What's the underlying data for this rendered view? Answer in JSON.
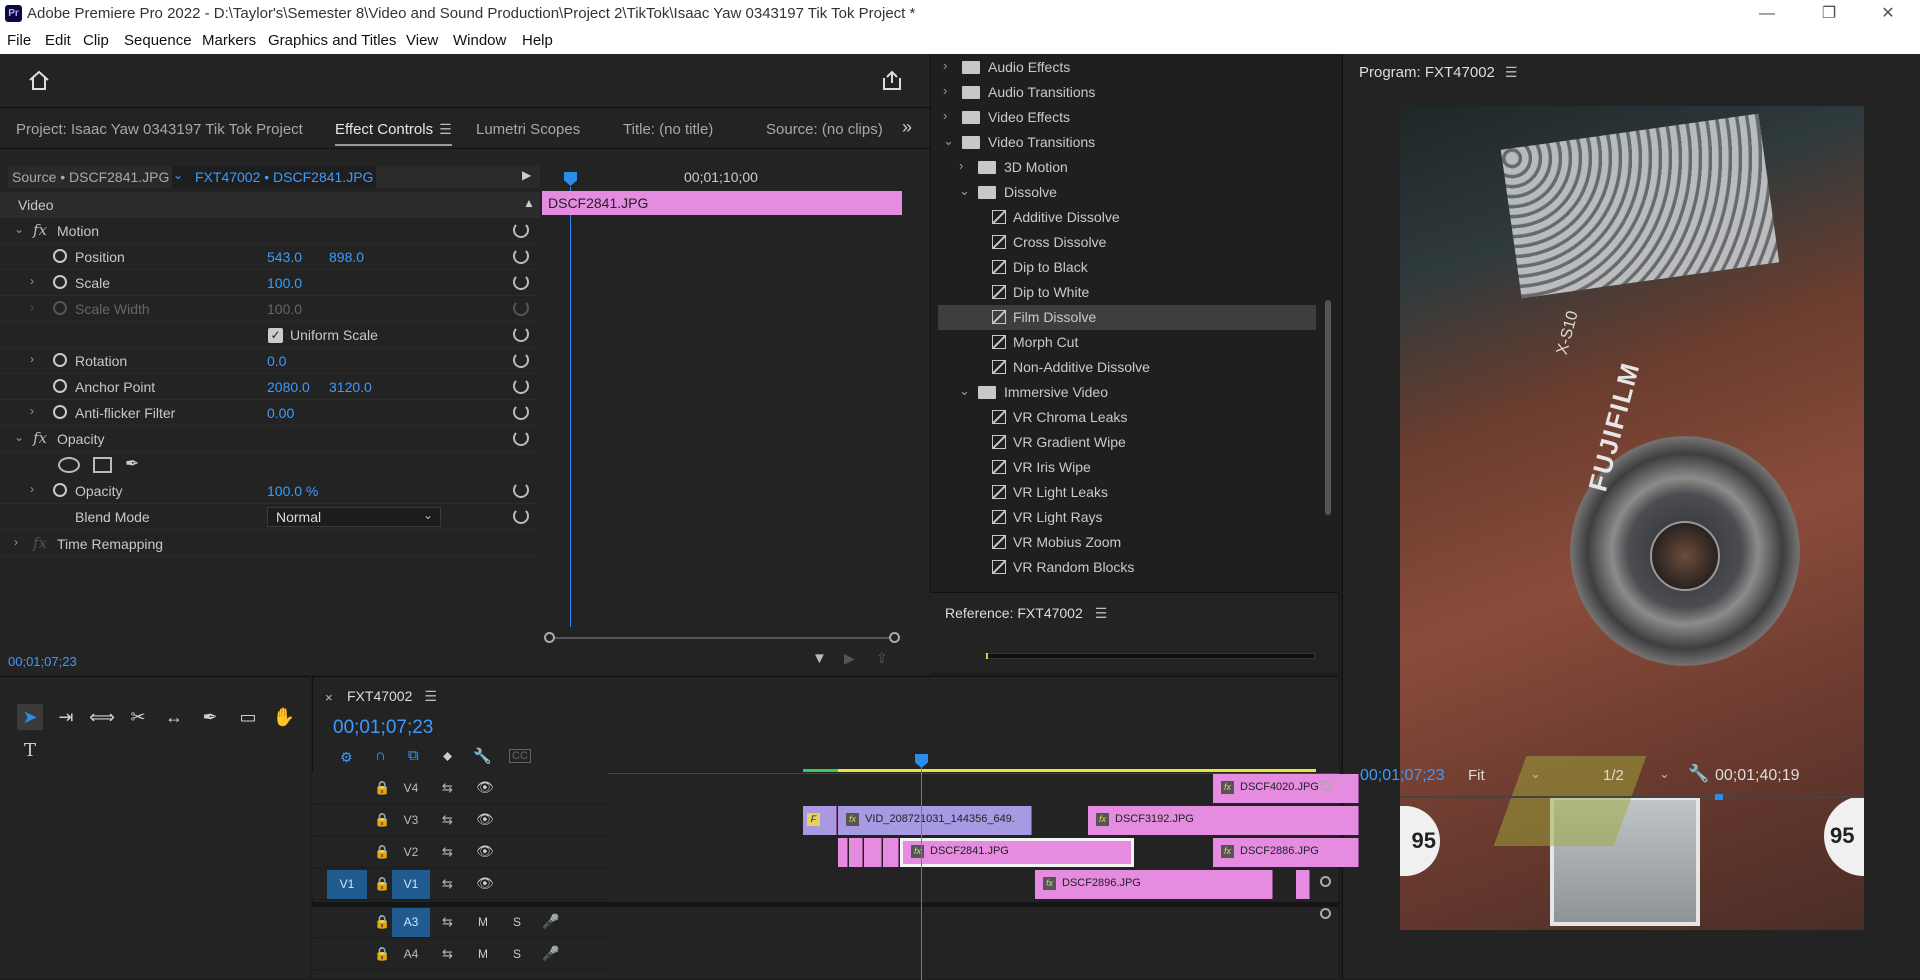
{
  "window": {
    "app_icon": "Pr",
    "title": "Adobe Premiere Pro 2022 - D:\\Taylor's\\Semester 8\\Video and Sound Production\\Project 2\\TikTok\\Isaac Yaw 0343197 Tik Tok Project *",
    "controls": [
      "—",
      "❐",
      "✕"
    ]
  },
  "menu": [
    "File",
    "Edit",
    "Clip",
    "Sequence",
    "Markers",
    "Graphics and Titles",
    "View",
    "Window",
    "Help"
  ],
  "panel_tabs": {
    "project": "Project: Isaac Yaw 0343197 Tik Tok Project",
    "effect_controls": "Effect Controls",
    "lumetri": "Lumetri Scopes",
    "title": "Title: (no title)",
    "source": "Source: (no clips)",
    "more": "»"
  },
  "effect_controls": {
    "source_label": "Source • DSCF2841.JPG",
    "sequence_label": "FXT47002 • DSCF2841.JPG",
    "timecode_ruler": "00;01;10;00",
    "clip_name": "DSCF2841.JPG",
    "section_video": "Video",
    "motion": "Motion",
    "position": {
      "label": "Position",
      "x": "543.0",
      "y": "898.0"
    },
    "scale": {
      "label": "Scale",
      "value": "100.0"
    },
    "scale_width": {
      "label": "Scale Width",
      "value": "100.0"
    },
    "uniform_scale": "Uniform Scale",
    "rotation": {
      "label": "Rotation",
      "value": "0.0"
    },
    "anchor_point": {
      "label": "Anchor Point",
      "x": "2080.0",
      "y": "3120.0"
    },
    "anti_flicker": {
      "label": "Anti-flicker Filter",
      "value": "0.00"
    },
    "opacity_section": "Opacity",
    "opacity": {
      "label": "Opacity",
      "value": "100.0 %"
    },
    "blend_mode": {
      "label": "Blend Mode",
      "value": "Normal"
    },
    "time_remapping": "Time Remapping",
    "current_time": "00;01;07;23"
  },
  "effects_tree": [
    {
      "label": "Audio Effects",
      "level": 0,
      "type": "folder",
      "open": false
    },
    {
      "label": "Audio Transitions",
      "level": 0,
      "type": "folder",
      "open": false
    },
    {
      "label": "Video Effects",
      "level": 0,
      "type": "folder",
      "open": false
    },
    {
      "label": "Video Transitions",
      "level": 0,
      "type": "folder",
      "open": true
    },
    {
      "label": "3D Motion",
      "level": 1,
      "type": "folder",
      "open": false
    },
    {
      "label": "Dissolve",
      "level": 1,
      "type": "folder",
      "open": true
    },
    {
      "label": "Additive Dissolve",
      "level": 2,
      "type": "effect"
    },
    {
      "label": "Cross Dissolve",
      "level": 2,
      "type": "effect"
    },
    {
      "label": "Dip to Black",
      "level": 2,
      "type": "effect"
    },
    {
      "label": "Dip to White",
      "level": 2,
      "type": "effect"
    },
    {
      "label": "Film Dissolve",
      "level": 2,
      "type": "effect",
      "selected": true
    },
    {
      "label": "Morph Cut",
      "level": 2,
      "type": "effect"
    },
    {
      "label": "Non-Additive Dissolve",
      "level": 2,
      "type": "effect"
    },
    {
      "label": "Immersive Video",
      "level": 1,
      "type": "folder",
      "open": true
    },
    {
      "label": "VR Chroma Leaks",
      "level": 2,
      "type": "effect"
    },
    {
      "label": "VR Gradient Wipe",
      "level": 2,
      "type": "effect"
    },
    {
      "label": "VR Iris Wipe",
      "level": 2,
      "type": "effect"
    },
    {
      "label": "VR Light Leaks",
      "level": 2,
      "type": "effect"
    },
    {
      "label": "VR Light Rays",
      "level": 2,
      "type": "effect"
    },
    {
      "label": "VR Mobius Zoom",
      "level": 2,
      "type": "effect"
    },
    {
      "label": "VR Random Blocks",
      "level": 2,
      "type": "effect"
    }
  ],
  "reference": {
    "title": "Reference: FXT47002"
  },
  "program": {
    "title": "Program: FXT47002",
    "timecode": "00;01;07;23",
    "fit": "Fit",
    "resolution": "1/2",
    "duration": "00;01;40;19",
    "image_texts": [
      "X-S10",
      "FUJIFILM",
      "95",
      "95"
    ]
  },
  "timeline": {
    "sequence": "FXT47002",
    "timecode": "00;01;07;23",
    "video_tracks": [
      {
        "name": "V4",
        "source": ""
      },
      {
        "name": "V3",
        "source": ""
      },
      {
        "name": "V2",
        "source": ""
      },
      {
        "name": "V1",
        "source": "V1"
      }
    ],
    "audio_tracks": [
      {
        "name": "A3",
        "m": "M",
        "s": "S"
      },
      {
        "name": "A4",
        "m": "M",
        "s": "S"
      }
    ],
    "clips": {
      "v4_a": "DSCF4020.JPG",
      "v3_a": "VID_208721031_144356_649.",
      "v3_b": "DSCF3192.JPG",
      "v3_small": "F",
      "v2_a": "DSCF2841.JPG",
      "v2_b": "DSCF2886.JPG",
      "v1_a": "DSCF2896.JPG"
    },
    "fx_badge": "fx"
  },
  "tools": {
    "text_tool": "T"
  },
  "colors": {
    "accent_blue": "#2d8ceb",
    "clip_pink": "#e58ce0",
    "clip_purple": "#a79ae3",
    "timecode_blue": "#3d9bff"
  }
}
